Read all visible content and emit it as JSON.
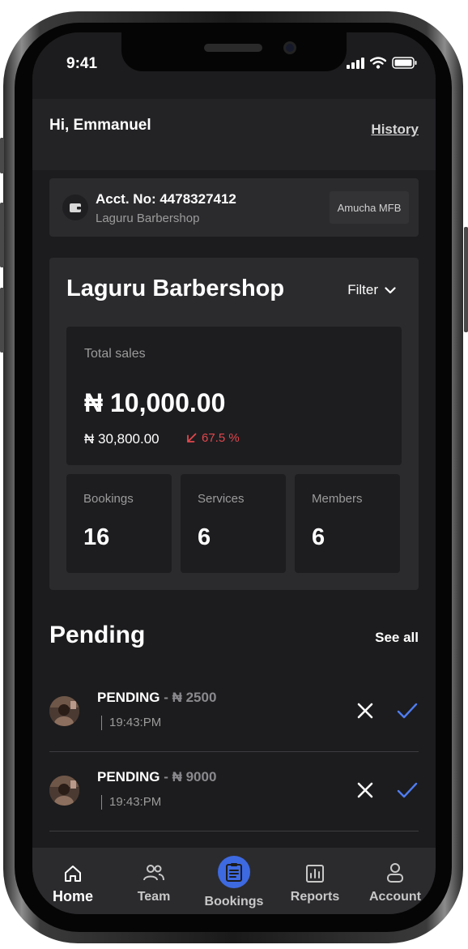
{
  "status_bar": {
    "time": "9:41"
  },
  "header": {
    "greeting": "Hi, Emmanuel",
    "history_link": "History"
  },
  "account": {
    "number": "Acct. No: 4478327412",
    "name": "Laguru Barbershop",
    "bank": "Amucha MFB",
    "icon": "wallet-icon"
  },
  "business": {
    "title": "Laguru Barbershop",
    "filter_label": "Filter",
    "total_sales": {
      "label": "Total sales",
      "amount": "₦ 10,000.00",
      "previous": "₦ 30,800.00",
      "change": "67.5 %",
      "change_direction": "down"
    },
    "stats": [
      {
        "label": "Bookings",
        "value": "16"
      },
      {
        "label": "Services",
        "value": "6"
      },
      {
        "label": "Members",
        "value": "6"
      }
    ]
  },
  "pending": {
    "title": "Pending",
    "see_all": "See all",
    "items": [
      {
        "status": "PENDING",
        "amount": "₦ 2500",
        "time": "19:43:PM"
      },
      {
        "status": "PENDING",
        "amount": "₦ 9000",
        "time": "19:43:PM"
      }
    ]
  },
  "tabs": [
    {
      "label": "Home",
      "icon": "home-icon",
      "active": true
    },
    {
      "label": "Team",
      "icon": "team-icon",
      "active": false
    },
    {
      "label": "Bookings",
      "icon": "clipboard-icon",
      "active": false
    },
    {
      "label": "Reports",
      "icon": "chart-icon",
      "active": false
    },
    {
      "label": "Account",
      "icon": "user-icon",
      "active": false
    }
  ],
  "colors": {
    "background": "#1c1c1e",
    "card": "#2b2b2e",
    "accent": "#3e6ae1",
    "negative": "#e0474c"
  }
}
